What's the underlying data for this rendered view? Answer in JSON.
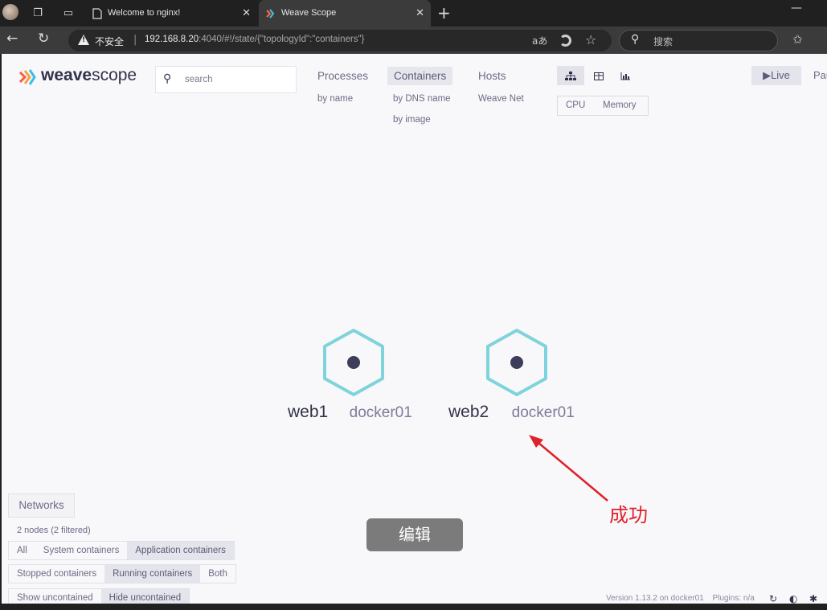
{
  "browser": {
    "tabs": [
      {
        "title": "Welcome to nginx!",
        "close": "✕"
      },
      {
        "title": "Weave Scope",
        "close": "✕"
      }
    ],
    "new_tab": "+",
    "minimize": "—",
    "address": {
      "security_label": "不安全",
      "url_host": "192.168.8.20",
      "url_rest": ":4040/#!/state/{\"topologyId\":\"containers\"}",
      "read_aloud": "aあ"
    },
    "search": {
      "placeholder": "搜索"
    }
  },
  "app": {
    "logo": {
      "bold": "weave",
      "light": "scope"
    },
    "search_placeholder": "search",
    "topologies": [
      {
        "label": "Processes",
        "active": false,
        "subs": [
          "by name"
        ]
      },
      {
        "label": "Containers",
        "active": true,
        "subs": [
          "by DNS name",
          "by image"
        ]
      },
      {
        "label": "Hosts",
        "active": false,
        "subs": [
          "Weave Net"
        ]
      }
    ],
    "views": [
      "graph-view-icon",
      "table-view-icon",
      "resources-view-icon"
    ],
    "metrics": [
      "CPU",
      "Memory"
    ],
    "live_label": "Live",
    "pause_label": "Pause"
  },
  "graph": {
    "nodes": [
      {
        "name": "web1",
        "host": "docker01"
      },
      {
        "name": "web2",
        "host": "docker01"
      }
    ]
  },
  "annotation": {
    "text": "成功",
    "edit_button": "编辑",
    "arrow_color": "#e0202a"
  },
  "controls": {
    "networks_label": "Networks",
    "node_count": "2 nodes (2 filtered)",
    "row1": [
      {
        "label": "All",
        "selected": false
      },
      {
        "label": "System containers",
        "selected": false
      },
      {
        "label": "Application containers",
        "selected": true
      }
    ],
    "row2": [
      {
        "label": "Stopped containers",
        "selected": false
      },
      {
        "label": "Running containers",
        "selected": true
      },
      {
        "label": "Both",
        "selected": false
      }
    ],
    "row3": [
      {
        "label": "Show uncontained",
        "selected": false
      },
      {
        "label": "Hide uncontained",
        "selected": true
      }
    ]
  },
  "footer": {
    "version_text": "Version 1.13.2 on docker01",
    "plugins_text": "Plugins: n/a"
  },
  "colors": {
    "node_stroke": "#7fd3da",
    "node_dot": "#3d3d5c",
    "accent_text": "#32324b"
  }
}
